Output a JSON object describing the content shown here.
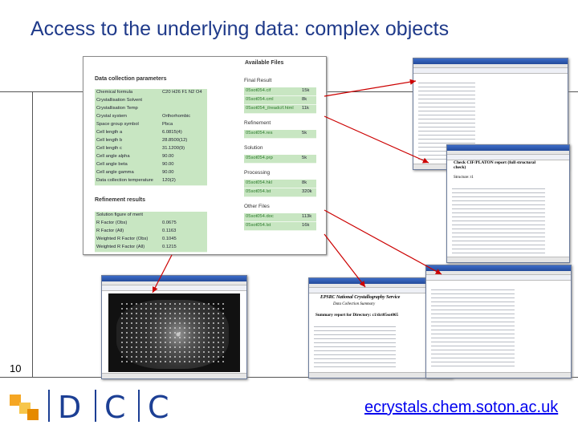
{
  "slide": {
    "title": "Access to the underlying data: complex objects",
    "number": "10",
    "url": "ecrystals.chem.soton.ac.uk",
    "logo": {
      "letters": [
        "D",
        "C",
        "C"
      ],
      "colors": [
        "#f5a623",
        "#f7c64b",
        "#e68a00"
      ]
    },
    "accent_color": "#1f3a8a",
    "arrow_color": "#cc0000"
  },
  "panel": {
    "collection_title": "Data collection parameters",
    "parameters": [
      {
        "k": "Chemical formula",
        "v": "C20 H26 F1 N2 O4"
      },
      {
        "k": "Crystallisation Solvent",
        "v": ""
      },
      {
        "k": "Crystallisation Temp",
        "v": ""
      },
      {
        "k": "Crystal system",
        "v": "Orthorhombic"
      },
      {
        "k": "Space group symbol",
        "v": "Pbca"
      },
      {
        "k": "Cell length a",
        "v": "6.0815(4)"
      },
      {
        "k": "Cell length b",
        "v": "28.8500(12)"
      },
      {
        "k": "Cell length c",
        "v": "31.1200(9)"
      },
      {
        "k": "Cell angle alpha",
        "v": "90.00"
      },
      {
        "k": "Cell angle beta",
        "v": "90.00"
      },
      {
        "k": "Cell angle gamma",
        "v": "90.00"
      },
      {
        "k": "Data collection temperature",
        "v": "120(2)"
      }
    ],
    "refinement_title": "Refinement results",
    "results": [
      {
        "k": "Solution figure of merit",
        "v": ""
      },
      {
        "k": "R Factor (Obs)",
        "v": "0.0675"
      },
      {
        "k": "R Factor (All)",
        "v": "0.1163"
      },
      {
        "k": "Weighted R Factor (Obs)",
        "v": "0.1045"
      },
      {
        "k": "Weighted R Factor (All)",
        "v": "0.1215"
      }
    ],
    "files_title": "Available Files",
    "file_sections": [
      {
        "name": "Final Result",
        "files": [
          {
            "n": "05sot054.cif",
            "s": "15k"
          },
          {
            "n": "05sot054.cml",
            "s": "8k"
          },
          {
            "n": "05sot054_ilreadcif.html",
            "s": "11k"
          }
        ]
      },
      {
        "name": "Refinement",
        "files": [
          {
            "n": "05sot054.res",
            "s": "5k"
          }
        ]
      },
      {
        "name": "Solution",
        "files": [
          {
            "n": "05sot054.prp",
            "s": "5k"
          }
        ]
      },
      {
        "name": "Processing",
        "files": [
          {
            "n": "05sot054.hkl",
            "s": "8k"
          },
          {
            "n": "05sot054.lst",
            "s": "320k"
          }
        ]
      },
      {
        "name": "Other Files",
        "files": [
          {
            "n": "05sot054.doc",
            "s": "113k"
          },
          {
            "n": "05sot054.lst",
            "s": "16k"
          }
        ]
      }
    ]
  },
  "windows": {
    "report_heading": "Check CIF/PLATON report (full structural check)",
    "report_sub": "Structure: t1",
    "summary_title": "EPSRC National Crystallography Service",
    "summary_sub": "Data Collection Summary",
    "summary_heading": "Summary report for Directory: c1/dct05sot065"
  }
}
